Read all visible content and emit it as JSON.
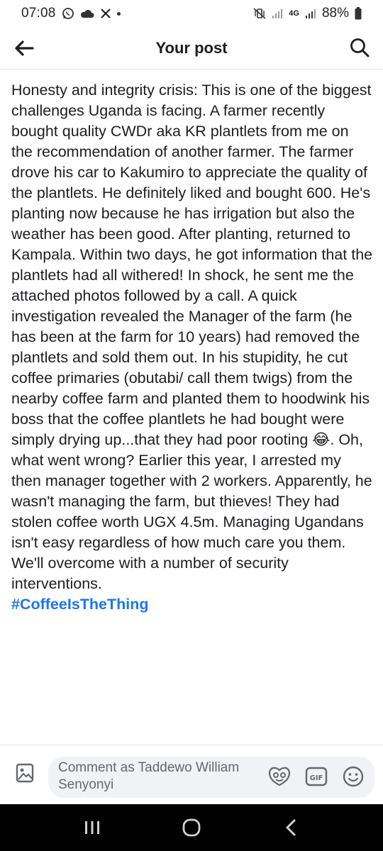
{
  "status_bar": {
    "time": "07:08",
    "notification_icons": [
      "whatsapp-icon",
      "cloud-icon",
      "x-icon",
      "dot-icon"
    ],
    "network": "4G",
    "battery": "88%"
  },
  "header": {
    "title": "Your post"
  },
  "post": {
    "text": "Honesty and integrity crisis: This is one of the biggest challenges Uganda is facing.  A farmer recently bought quality CWDr aka KR plantlets from me on the recommendation of another farmer. The farmer drove his car to Kakumiro to appreciate the quality of the plantlets.  He definitely liked and bought 600. He's planting now because he has irrigation but also the weather has been good. After planting, returned to Kampala.  Within two days, he got information that the plantlets had all withered! In shock, he sent me the attached photos followed by a call. A quick investigation revealed the Manager of the farm (he has been at the farm for 10 years) had removed the plantlets and sold them out. In his stupidity, he cut coffee primaries (obutabi/ call them twigs) from the nearby coffee farm and planted them to hoodwink his boss that the coffee plantlets he had bought were simply drying up...that they had poor rooting 😂. Oh, what went wrong? Earlier this year, I arrested my then manager together with 2 workers. Apparently, he wasn't managing the farm, but thieves! They had stolen coffee worth UGX 4.5m. Managing Ugandans isn't easy regardless of how much care you them. We'll overcome with a number of security interventions.",
    "hashtag": "#CoffeeIsTheThing"
  },
  "comment_bar": {
    "placeholder": "Comment as Taddewo William Senyonyi",
    "tools": [
      "avatar-sticker-icon",
      "gif-icon",
      "emoji-icon"
    ]
  },
  "nav_bar": {
    "buttons": [
      "recent-apps-icon",
      "home-icon",
      "back-icon"
    ]
  },
  "colors": {
    "accent": "#1877f2",
    "text": "#1c1e21",
    "secondary_text": "#65676b",
    "input_bg": "#f0f2f5",
    "nav_bg": "#000000"
  }
}
